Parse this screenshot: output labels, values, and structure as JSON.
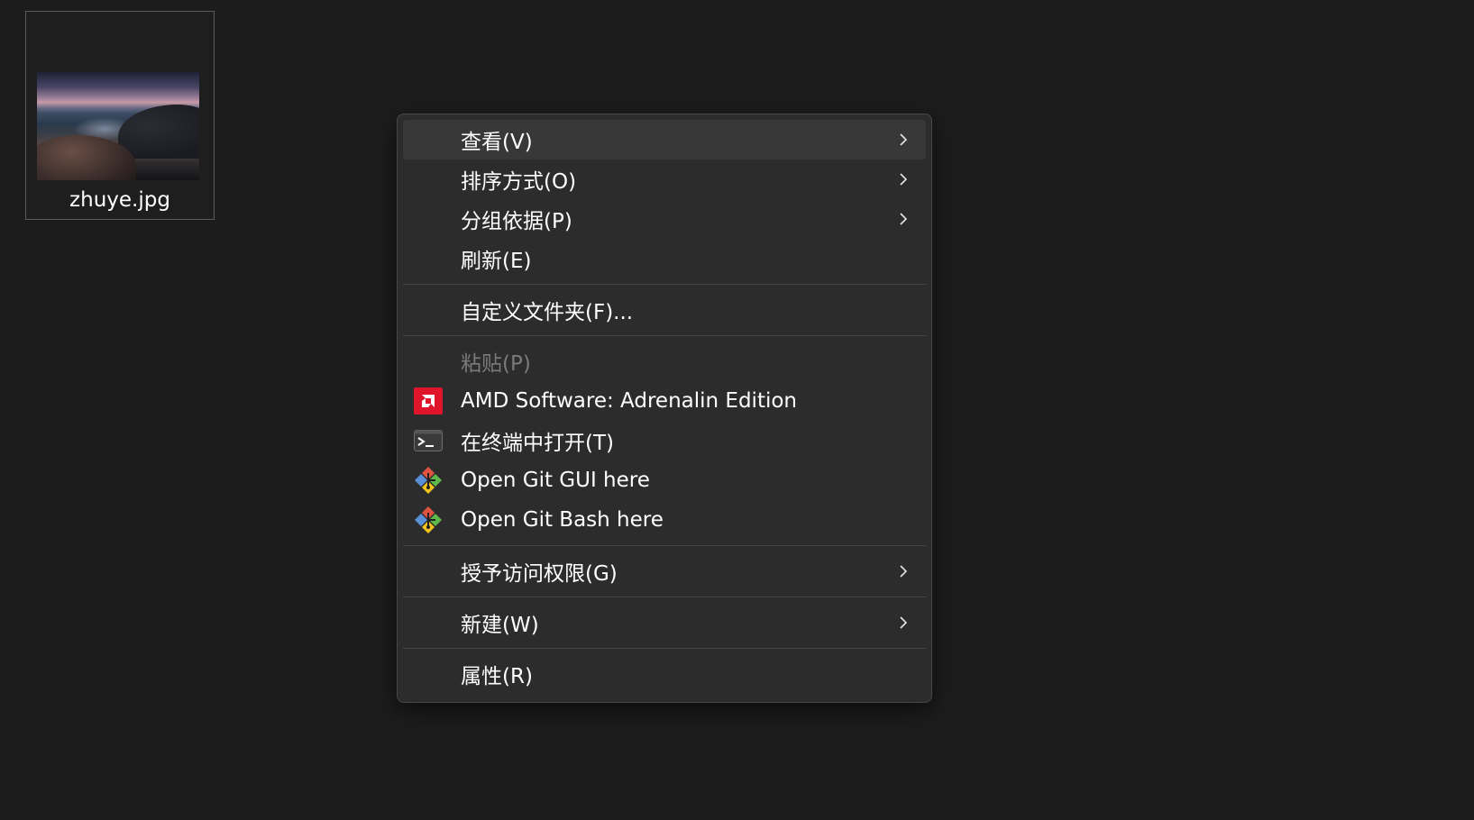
{
  "desktop": {
    "file": {
      "name": "zhuye.jpg"
    }
  },
  "context_menu": {
    "items": [
      {
        "label": "查看(V)",
        "submenu": true,
        "state": "hover"
      },
      {
        "label": "排序方式(O)",
        "submenu": true
      },
      {
        "label": "分组依据(P)",
        "submenu": true
      },
      {
        "label": "刷新(E)"
      },
      {
        "label": "自定义文件夹(F)..."
      },
      {
        "label": "粘贴(P)",
        "disabled": true
      },
      {
        "label": "AMD Software: Adrenalin Edition",
        "icon": "amd-icon"
      },
      {
        "label": "在终端中打开(T)",
        "icon": "terminal-icon"
      },
      {
        "label": "Open Git GUI here",
        "icon": "git-icon"
      },
      {
        "label": "Open Git Bash here",
        "icon": "git-icon"
      },
      {
        "label": "授予访问权限(G)",
        "submenu": true
      },
      {
        "label": "新建(W)",
        "submenu": true
      },
      {
        "label": "属性(R)"
      }
    ]
  },
  "colors": {
    "background": "#1c1c1c",
    "menu_background": "#2c2c2c",
    "hover": "#383838",
    "amd_red": "#e0152b",
    "disabled_text": "#7a7a7a"
  }
}
